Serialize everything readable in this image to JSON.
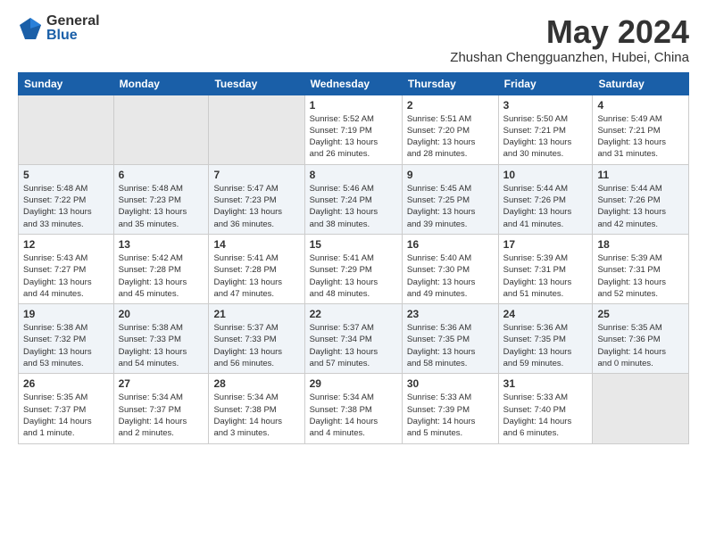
{
  "logo": {
    "general": "General",
    "blue": "Blue"
  },
  "title": "May 2024",
  "location": "Zhushan Chengguanzhen, Hubei, China",
  "weekdays": [
    "Sunday",
    "Monday",
    "Tuesday",
    "Wednesday",
    "Thursday",
    "Friday",
    "Saturday"
  ],
  "weeks": [
    [
      {
        "day": "",
        "info": ""
      },
      {
        "day": "",
        "info": ""
      },
      {
        "day": "",
        "info": ""
      },
      {
        "day": "1",
        "info": "Sunrise: 5:52 AM\nSunset: 7:19 PM\nDaylight: 13 hours\nand 26 minutes."
      },
      {
        "day": "2",
        "info": "Sunrise: 5:51 AM\nSunset: 7:20 PM\nDaylight: 13 hours\nand 28 minutes."
      },
      {
        "day": "3",
        "info": "Sunrise: 5:50 AM\nSunset: 7:21 PM\nDaylight: 13 hours\nand 30 minutes."
      },
      {
        "day": "4",
        "info": "Sunrise: 5:49 AM\nSunset: 7:21 PM\nDaylight: 13 hours\nand 31 minutes."
      }
    ],
    [
      {
        "day": "5",
        "info": "Sunrise: 5:48 AM\nSunset: 7:22 PM\nDaylight: 13 hours\nand 33 minutes."
      },
      {
        "day": "6",
        "info": "Sunrise: 5:48 AM\nSunset: 7:23 PM\nDaylight: 13 hours\nand 35 minutes."
      },
      {
        "day": "7",
        "info": "Sunrise: 5:47 AM\nSunset: 7:23 PM\nDaylight: 13 hours\nand 36 minutes."
      },
      {
        "day": "8",
        "info": "Sunrise: 5:46 AM\nSunset: 7:24 PM\nDaylight: 13 hours\nand 38 minutes."
      },
      {
        "day": "9",
        "info": "Sunrise: 5:45 AM\nSunset: 7:25 PM\nDaylight: 13 hours\nand 39 minutes."
      },
      {
        "day": "10",
        "info": "Sunrise: 5:44 AM\nSunset: 7:26 PM\nDaylight: 13 hours\nand 41 minutes."
      },
      {
        "day": "11",
        "info": "Sunrise: 5:44 AM\nSunset: 7:26 PM\nDaylight: 13 hours\nand 42 minutes."
      }
    ],
    [
      {
        "day": "12",
        "info": "Sunrise: 5:43 AM\nSunset: 7:27 PM\nDaylight: 13 hours\nand 44 minutes."
      },
      {
        "day": "13",
        "info": "Sunrise: 5:42 AM\nSunset: 7:28 PM\nDaylight: 13 hours\nand 45 minutes."
      },
      {
        "day": "14",
        "info": "Sunrise: 5:41 AM\nSunset: 7:28 PM\nDaylight: 13 hours\nand 47 minutes."
      },
      {
        "day": "15",
        "info": "Sunrise: 5:41 AM\nSunset: 7:29 PM\nDaylight: 13 hours\nand 48 minutes."
      },
      {
        "day": "16",
        "info": "Sunrise: 5:40 AM\nSunset: 7:30 PM\nDaylight: 13 hours\nand 49 minutes."
      },
      {
        "day": "17",
        "info": "Sunrise: 5:39 AM\nSunset: 7:31 PM\nDaylight: 13 hours\nand 51 minutes."
      },
      {
        "day": "18",
        "info": "Sunrise: 5:39 AM\nSunset: 7:31 PM\nDaylight: 13 hours\nand 52 minutes."
      }
    ],
    [
      {
        "day": "19",
        "info": "Sunrise: 5:38 AM\nSunset: 7:32 PM\nDaylight: 13 hours\nand 53 minutes."
      },
      {
        "day": "20",
        "info": "Sunrise: 5:38 AM\nSunset: 7:33 PM\nDaylight: 13 hours\nand 54 minutes."
      },
      {
        "day": "21",
        "info": "Sunrise: 5:37 AM\nSunset: 7:33 PM\nDaylight: 13 hours\nand 56 minutes."
      },
      {
        "day": "22",
        "info": "Sunrise: 5:37 AM\nSunset: 7:34 PM\nDaylight: 13 hours\nand 57 minutes."
      },
      {
        "day": "23",
        "info": "Sunrise: 5:36 AM\nSunset: 7:35 PM\nDaylight: 13 hours\nand 58 minutes."
      },
      {
        "day": "24",
        "info": "Sunrise: 5:36 AM\nSunset: 7:35 PM\nDaylight: 13 hours\nand 59 minutes."
      },
      {
        "day": "25",
        "info": "Sunrise: 5:35 AM\nSunset: 7:36 PM\nDaylight: 14 hours\nand 0 minutes."
      }
    ],
    [
      {
        "day": "26",
        "info": "Sunrise: 5:35 AM\nSunset: 7:37 PM\nDaylight: 14 hours\nand 1 minute."
      },
      {
        "day": "27",
        "info": "Sunrise: 5:34 AM\nSunset: 7:37 PM\nDaylight: 14 hours\nand 2 minutes."
      },
      {
        "day": "28",
        "info": "Sunrise: 5:34 AM\nSunset: 7:38 PM\nDaylight: 14 hours\nand 3 minutes."
      },
      {
        "day": "29",
        "info": "Sunrise: 5:34 AM\nSunset: 7:38 PM\nDaylight: 14 hours\nand 4 minutes."
      },
      {
        "day": "30",
        "info": "Sunrise: 5:33 AM\nSunset: 7:39 PM\nDaylight: 14 hours\nand 5 minutes."
      },
      {
        "day": "31",
        "info": "Sunrise: 5:33 AM\nSunset: 7:40 PM\nDaylight: 14 hours\nand 6 minutes."
      },
      {
        "day": "",
        "info": ""
      }
    ]
  ]
}
